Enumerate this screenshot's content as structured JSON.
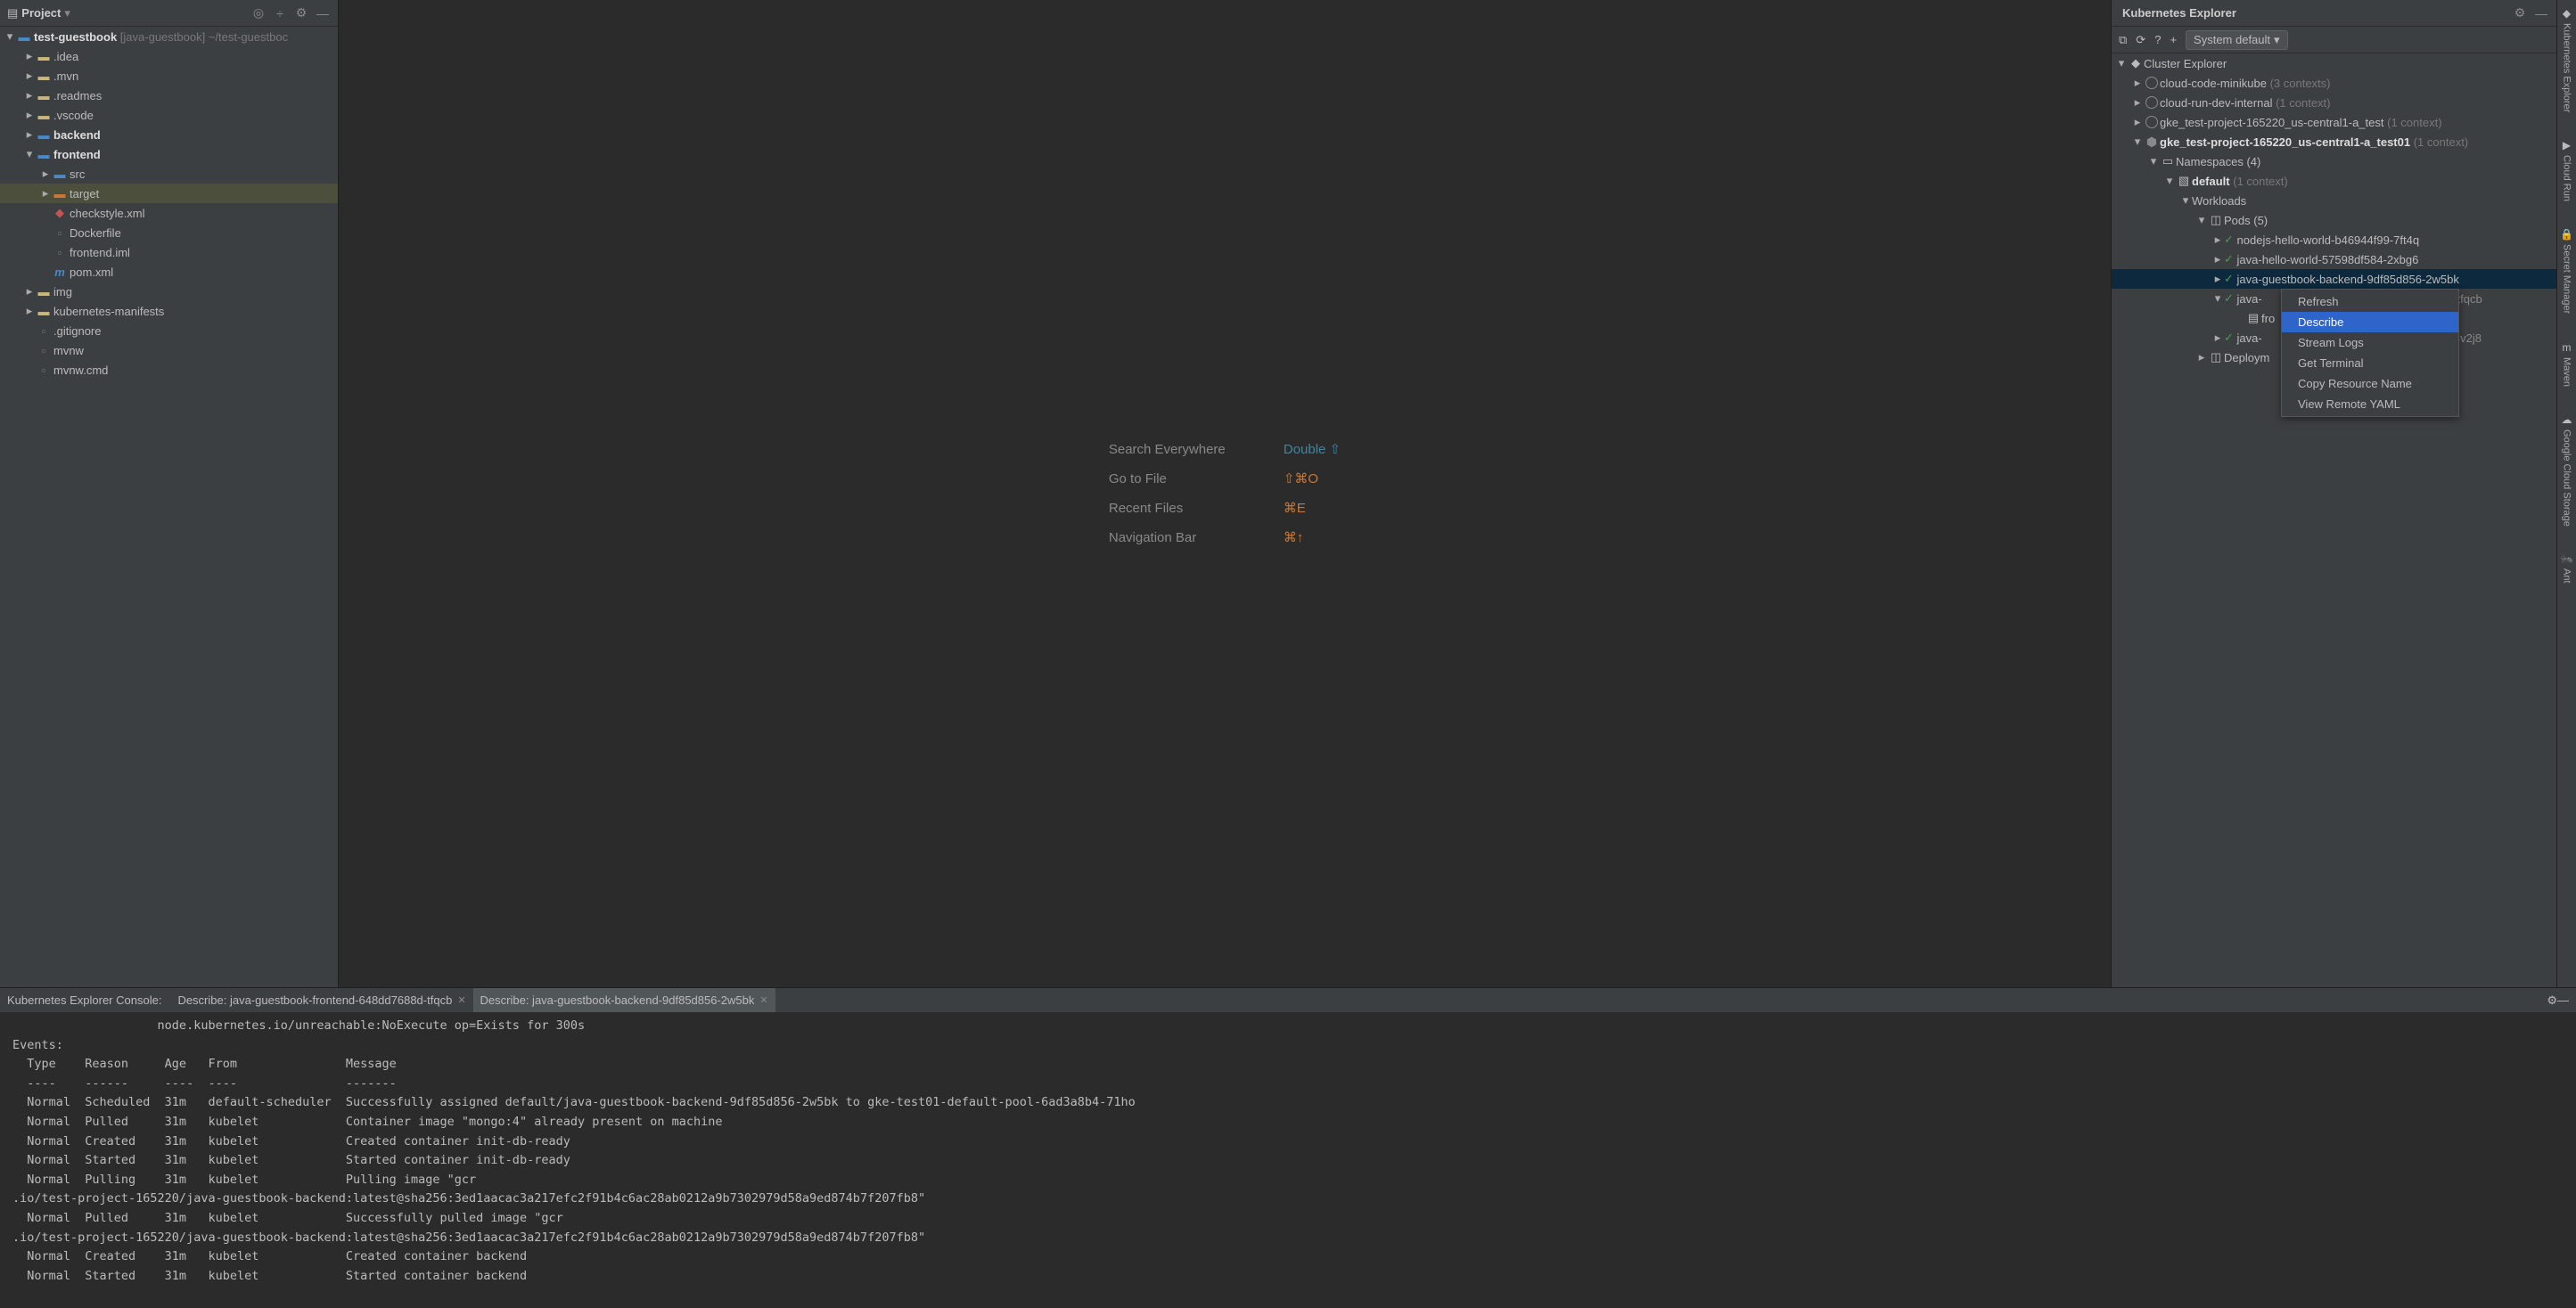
{
  "project_panel": {
    "title": "Project",
    "root": {
      "name": "test-guestbook",
      "alt": "[java-guestbook]",
      "path": "~/test-guestboc"
    },
    "items": [
      {
        "depth": 1,
        "arrow": ">",
        "icon": "folder",
        "name": ".idea",
        "cls": ""
      },
      {
        "depth": 1,
        "arrow": ">",
        "icon": "folder",
        "name": ".mvn",
        "cls": ""
      },
      {
        "depth": 1,
        "arrow": ">",
        "icon": "folder",
        "name": ".readmes",
        "cls": ""
      },
      {
        "depth": 1,
        "arrow": ">",
        "icon": "folder",
        "name": ".vscode",
        "cls": ""
      },
      {
        "depth": 1,
        "arrow": ">",
        "icon": "folder-blue",
        "name": "backend",
        "bold": true
      },
      {
        "depth": 1,
        "arrow": "v",
        "icon": "folder-blue",
        "name": "frontend",
        "bold": true
      },
      {
        "depth": 2,
        "arrow": ">",
        "icon": "folder-blue",
        "name": "src"
      },
      {
        "depth": 2,
        "arrow": ">",
        "icon": "folder-orange",
        "name": "target",
        "rowcls": "targ"
      },
      {
        "depth": 2,
        "arrow": "",
        "icon": "xml",
        "name": "checkstyle.xml"
      },
      {
        "depth": 2,
        "arrow": "",
        "icon": "file",
        "name": "Dockerfile"
      },
      {
        "depth": 2,
        "arrow": "",
        "icon": "iml",
        "name": "frontend.iml"
      },
      {
        "depth": 2,
        "arrow": "",
        "icon": "m",
        "name": "pom.xml"
      },
      {
        "depth": 1,
        "arrow": ">",
        "icon": "folder",
        "name": "img"
      },
      {
        "depth": 1,
        "arrow": ">",
        "icon": "folder",
        "name": "kubernetes-manifests"
      },
      {
        "depth": 1,
        "arrow": "",
        "icon": "file",
        "name": ".gitignore"
      },
      {
        "depth": 1,
        "arrow": "",
        "icon": "file",
        "name": "mvnw"
      },
      {
        "depth": 1,
        "arrow": "",
        "icon": "file",
        "name": "mvnw.cmd"
      }
    ]
  },
  "editor_help": [
    {
      "label": "Search Everywhere",
      "keys": "Double ⇧",
      "style": "blue"
    },
    {
      "label": "Go to File",
      "keys": "⇧⌘O",
      "style": ""
    },
    {
      "label": "Recent Files",
      "keys": "⌘E",
      "style": ""
    },
    {
      "label": "Navigation Bar",
      "keys": "⌘↑",
      "style": ""
    }
  ],
  "k8s": {
    "title": "Kubernetes Explorer",
    "button": "System default",
    "root": "Cluster Explorer",
    "clusters": [
      {
        "name": "cloud-code-minikube",
        "ctx": "(3 contexts)",
        "arrow": ">",
        "icon": "circle"
      },
      {
        "name": "cloud-run-dev-internal",
        "ctx": "(1 context)",
        "arrow": ">",
        "icon": "circle"
      },
      {
        "name": "gke_test-project-165220_us-central1-a_test",
        "ctx": "(1 context)",
        "arrow": ">",
        "icon": "circle"
      },
      {
        "name": "gke_test-project-165220_us-central1-a_test01",
        "ctx": "(1 context)",
        "arrow": "v",
        "icon": "hex",
        "bold": true
      }
    ],
    "ns_label": "Namespaces (4)",
    "default_label": "default",
    "default_ctx": "(1 context)",
    "workloads": "Workloads",
    "pods_label": "Pods (5)",
    "pods": [
      {
        "name": "nodejs-hello-world-b46944f99-7ft4q",
        "arrow": ">"
      },
      {
        "name": "java-hello-world-57598df584-2xbg6",
        "arrow": ">"
      },
      {
        "name": "java-guestbook-backend-9df85d856-2w5bk",
        "arrow": ">",
        "sel": true
      },
      {
        "name": "java-guestbook-frontend-648dd7688d-tfqcb",
        "arrow": "v",
        "trunc": "java-"
      },
      {
        "name": "java-guestbook-mongodb-79755b45f9-4v2j8",
        "arrow": ">",
        "trunc": "java-"
      }
    ],
    "container": "fro",
    "deployments": "Deploym",
    "menu": [
      "Refresh",
      "Describe",
      "Stream Logs",
      "Get Terminal",
      "Copy Resource Name",
      "View Remote YAML"
    ],
    "menu_sel": "Describe"
  },
  "right_tabs": [
    "Kubernetes Explorer",
    "Cloud Run",
    "Secret Manager",
    "Maven",
    "Google Cloud Storage",
    "Ant"
  ],
  "bottom": {
    "console_title": "Kubernetes Explorer Console:",
    "tabs": [
      {
        "label": "Describe: java-guestbook-frontend-648dd7688d-tfqcb"
      },
      {
        "label": "Describe: java-guestbook-backend-9df85d856-2w5bk",
        "active": true
      }
    ],
    "text": "                    node.kubernetes.io/unreachable:NoExecute op=Exists for 300s\nEvents:\n  Type    Reason     Age   From               Message\n  ----    ------     ----  ----               -------\n  Normal  Scheduled  31m   default-scheduler  Successfully assigned default/java-guestbook-backend-9df85d856-2w5bk to gke-test01-default-pool-6ad3a8b4-71ho\n  Normal  Pulled     31m   kubelet            Container image \"mongo:4\" already present on machine\n  Normal  Created    31m   kubelet            Created container init-db-ready\n  Normal  Started    31m   kubelet            Started container init-db-ready\n  Normal  Pulling    31m   kubelet            Pulling image \"gcr\n.io/test-project-165220/java-guestbook-backend:latest@sha256:3ed1aacac3a217efc2f91b4c6ac28ab0212a9b7302979d58a9ed874b7f207fb8\"\n  Normal  Pulled     31m   kubelet            Successfully pulled image \"gcr\n.io/test-project-165220/java-guestbook-backend:latest@sha256:3ed1aacac3a217efc2f91b4c6ac28ab0212a9b7302979d58a9ed874b7f207fb8\"\n  Normal  Created    31m   kubelet            Created container backend\n  Normal  Started    31m   kubelet            Started container backend"
  }
}
